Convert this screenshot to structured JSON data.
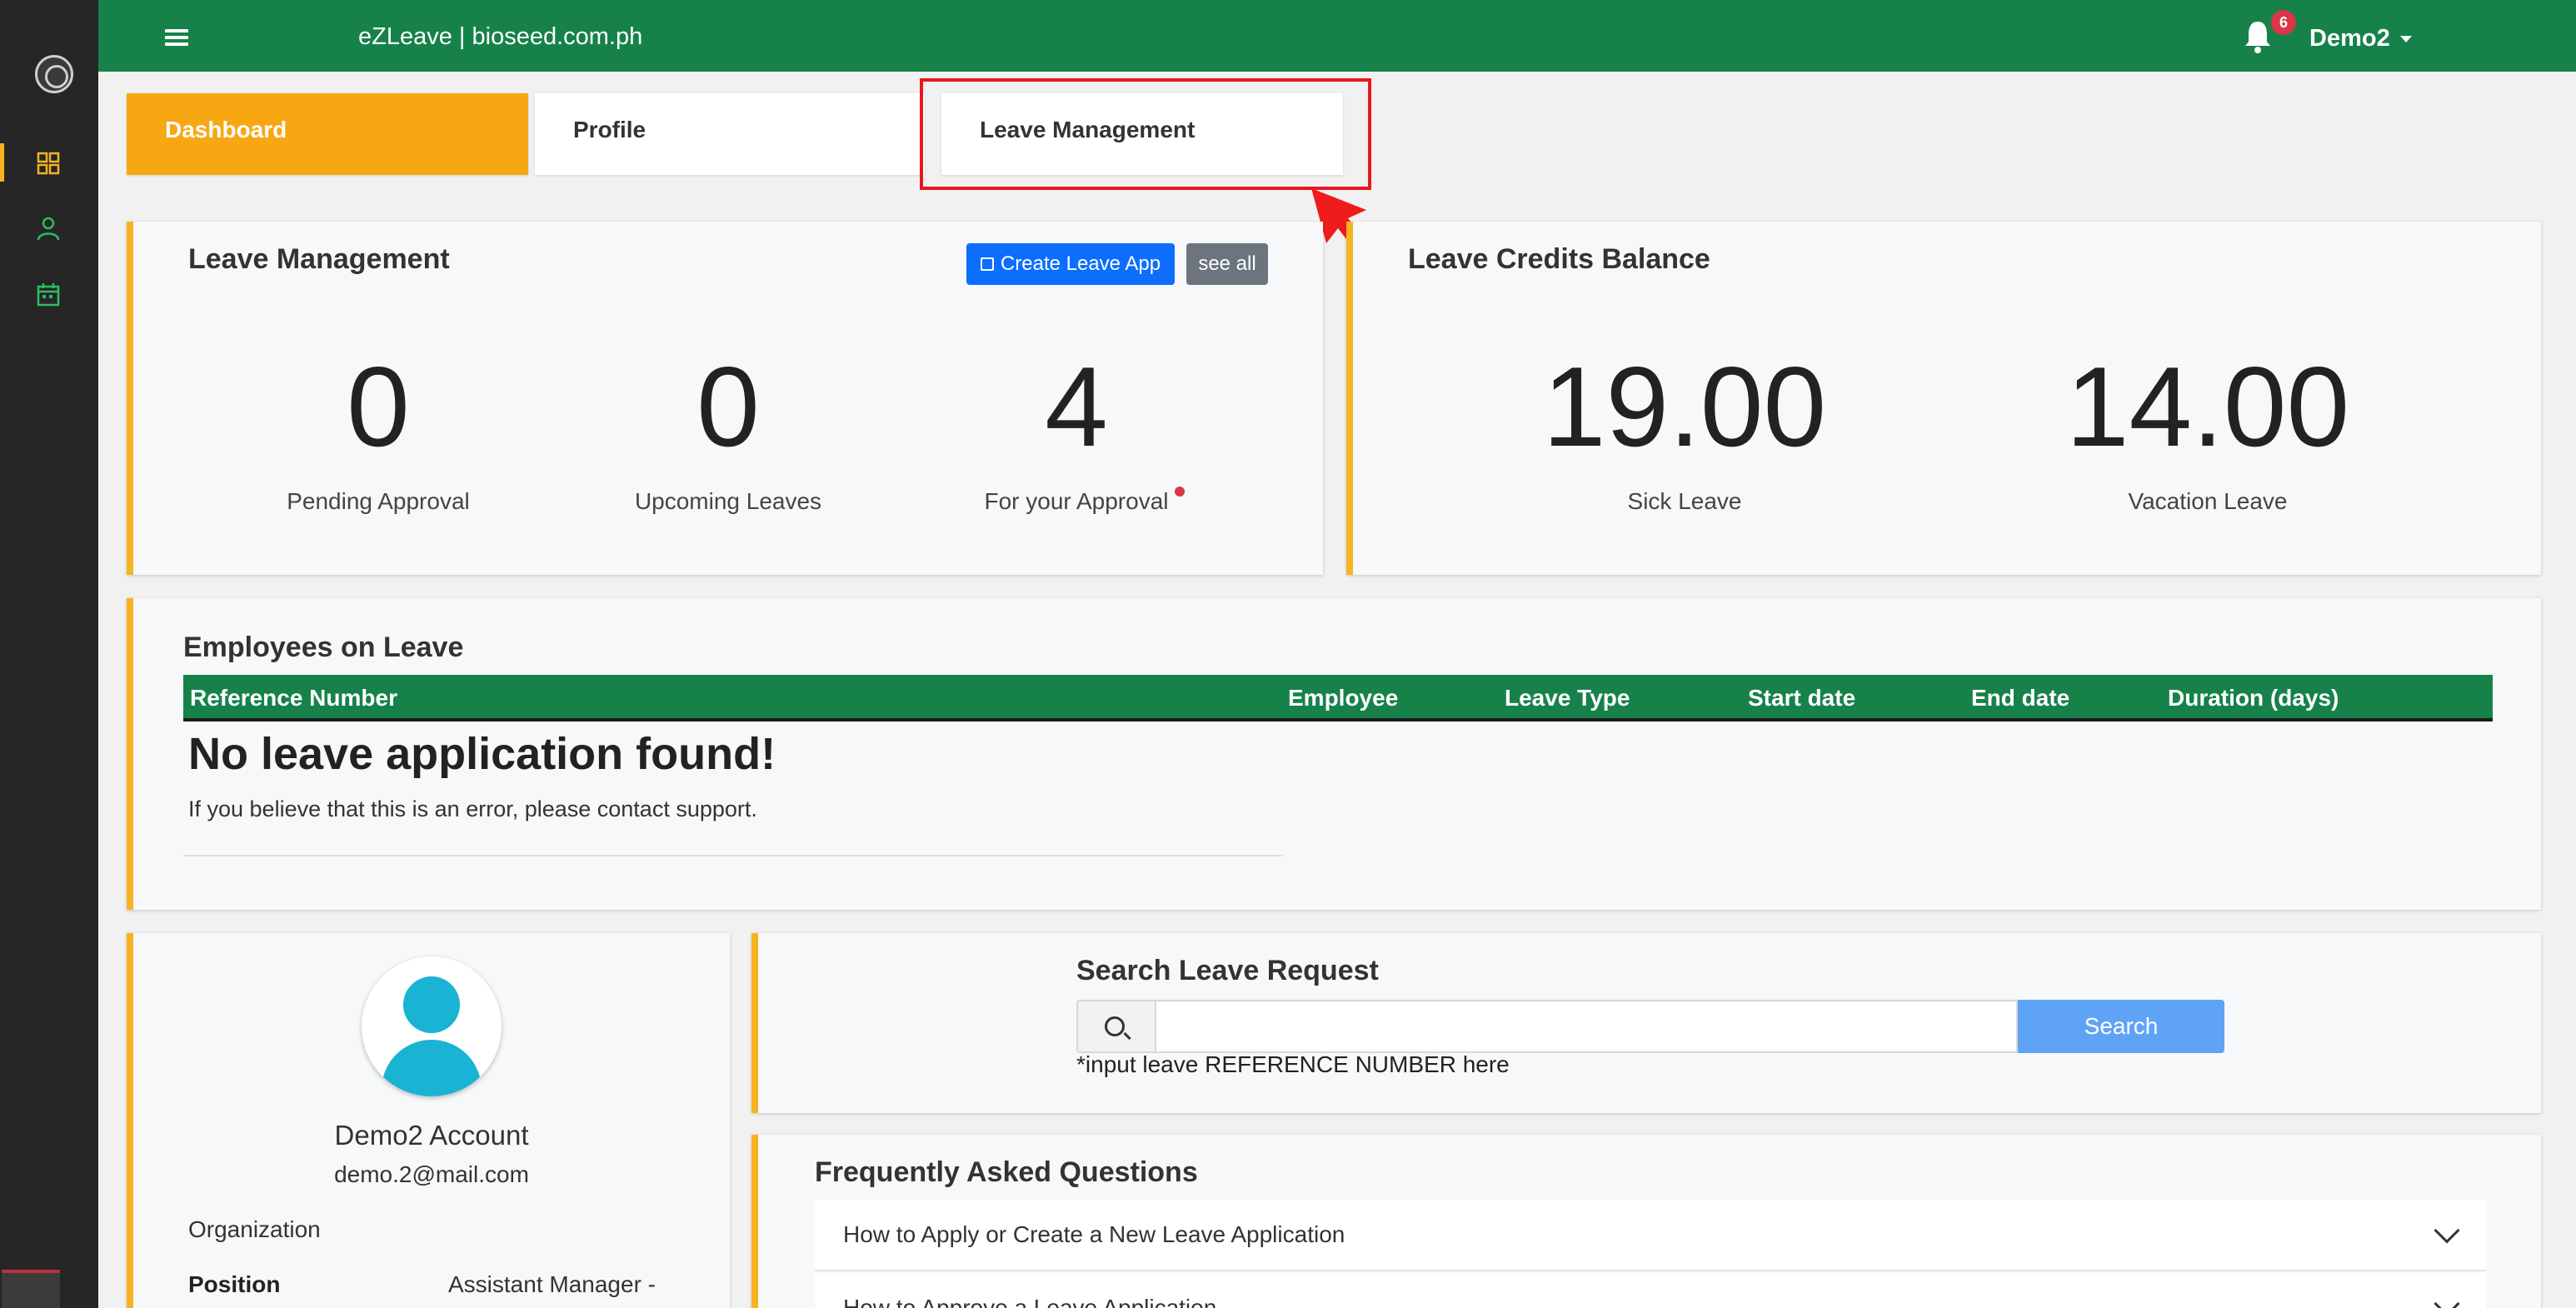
{
  "app": {
    "title": "eZLeave | bioseed.com.ph"
  },
  "header": {
    "notification_count": "6",
    "user_name": "Demo2"
  },
  "tabs": [
    {
      "label": "Dashboard",
      "active": true
    },
    {
      "label": "Profile",
      "active": false
    },
    {
      "label": "Leave Management",
      "active": false
    }
  ],
  "leave_management": {
    "title": "Leave Management",
    "create_button": "Create Leave App",
    "see_all_button": "see all",
    "stats": [
      {
        "value": "0",
        "label": "Pending Approval"
      },
      {
        "value": "0",
        "label": "Upcoming Leaves"
      },
      {
        "value": "4",
        "label": "For your Approval"
      }
    ]
  },
  "leave_credits": {
    "title": "Leave Credits Balance",
    "stats": [
      {
        "value": "19.00",
        "label": "Sick Leave"
      },
      {
        "value": "14.00",
        "label": "Vacation Leave"
      }
    ]
  },
  "employees_on_leave": {
    "title": "Employees on Leave",
    "columns": [
      "Reference Number",
      "Employee",
      "Leave Type",
      "Start date",
      "End date",
      "Duration (days)"
    ],
    "empty_title": "No leave application found!",
    "empty_message": "If you believe that this is an error, please contact support."
  },
  "profile": {
    "name": "Demo2 Account",
    "email": "demo.2@mail.com",
    "organization_label": "Organization",
    "position_label": "Position",
    "position_value": "Assistant Manager -"
  },
  "search": {
    "title": "Search Leave Request",
    "input_value": "",
    "button": "Search",
    "hint": "*input leave REFERENCE NUMBER here"
  },
  "faq": {
    "title": "Frequently Asked Questions",
    "items": [
      "How to Apply or Create a New Leave Application",
      "How to Approve a Leave Application"
    ]
  },
  "colors": {
    "brand_green": "#16824a",
    "accent_orange": "#f7a712",
    "card_border": "#f7b321",
    "primary_blue": "#0d6efd",
    "highlight_red": "#e8171f"
  },
  "icons": {
    "rail": [
      "dashboard-grid-icon",
      "user-icon",
      "calendar-icon"
    ],
    "header": [
      "hamburger-icon",
      "bell-icon"
    ],
    "search": "magnifier-icon",
    "faq": "chevron-down-icon"
  }
}
